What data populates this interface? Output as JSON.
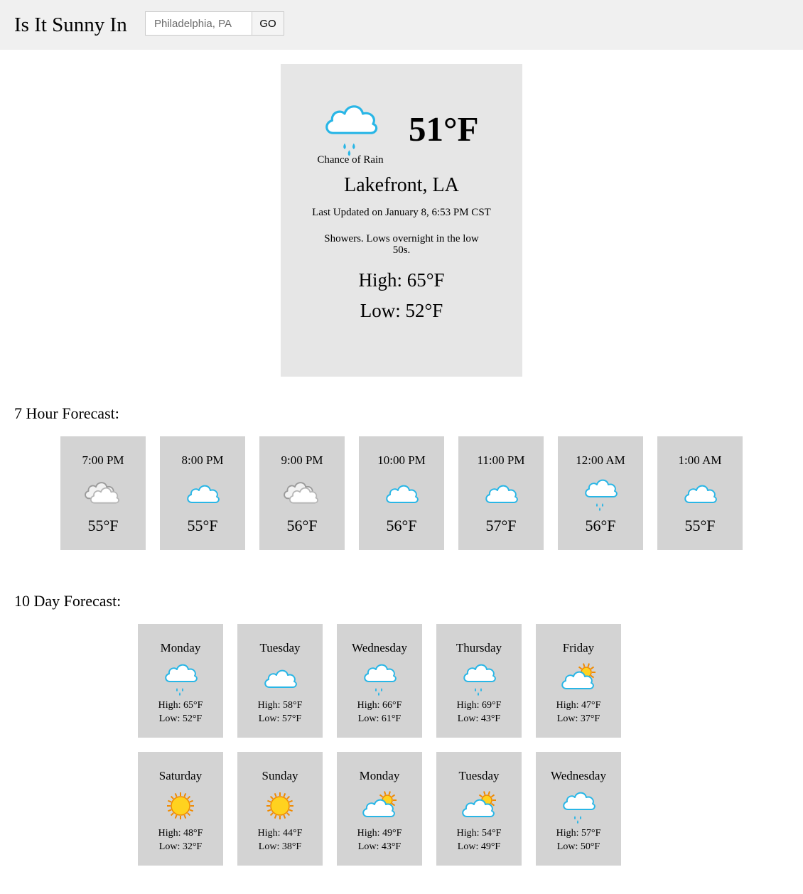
{
  "header": {
    "title": "Is It Sunny In",
    "search_placeholder": "Philadelphia, PA",
    "go_label": "GO"
  },
  "current": {
    "icon": "chance-rain-icon",
    "temperature": "51°F",
    "condition": "Chance of Rain",
    "location": "Lakefront, LA",
    "last_updated": "Last Updated on January 8, 6:53 PM CST",
    "summary": "Showers. Lows overnight in the low 50s.",
    "high": "High: 65°F",
    "low": "Low: 52°F"
  },
  "hourly": {
    "heading": "7 Hour Forecast:",
    "items": [
      {
        "time": "7:00 PM",
        "icon": "cloudy-icon",
        "temp": "55°F"
      },
      {
        "time": "8:00 PM",
        "icon": "mostly-cloudy-icon",
        "temp": "55°F"
      },
      {
        "time": "9:00 PM",
        "icon": "cloudy-icon",
        "temp": "56°F"
      },
      {
        "time": "10:00 PM",
        "icon": "mostly-cloudy-icon",
        "temp": "56°F"
      },
      {
        "time": "11:00 PM",
        "icon": "mostly-cloudy-icon",
        "temp": "57°F"
      },
      {
        "time": "12:00 AM",
        "icon": "chance-rain-icon",
        "temp": "56°F"
      },
      {
        "time": "1:00 AM",
        "icon": "mostly-cloudy-icon",
        "temp": "55°F"
      }
    ]
  },
  "daily": {
    "heading": "10 Day Forecast:",
    "items": [
      {
        "day": "Monday",
        "icon": "chance-rain-icon",
        "high": "High: 65°F",
        "low": "Low: 52°F"
      },
      {
        "day": "Tuesday",
        "icon": "mostly-cloudy-icon",
        "high": "High: 58°F",
        "low": "Low: 57°F"
      },
      {
        "day": "Wednesday",
        "icon": "chance-rain-icon",
        "high": "High: 66°F",
        "low": "Low: 61°F"
      },
      {
        "day": "Thursday",
        "icon": "chance-rain-icon",
        "high": "High: 69°F",
        "low": "Low: 43°F"
      },
      {
        "day": "Friday",
        "icon": "partly-cloudy-icon",
        "high": "High: 47°F",
        "low": "Low: 37°F"
      },
      {
        "day": "Saturday",
        "icon": "sunny-icon",
        "high": "High: 48°F",
        "low": "Low: 32°F"
      },
      {
        "day": "Sunday",
        "icon": "sunny-icon",
        "high": "High: 44°F",
        "low": "Low: 38°F"
      },
      {
        "day": "Monday",
        "icon": "partly-cloudy-icon",
        "high": "High: 49°F",
        "low": "Low: 43°F"
      },
      {
        "day": "Tuesday",
        "icon": "partly-cloudy-icon",
        "high": "High: 54°F",
        "low": "Low: 49°F"
      },
      {
        "day": "Wednesday",
        "icon": "chance-rain-icon",
        "high": "High: 57°F",
        "low": "Low: 50°F"
      }
    ]
  },
  "colors": {
    "header_bg": "#f0f0f0",
    "current_card_bg": "#e6e6e6",
    "forecast_card_bg": "#d3d3d3",
    "cloud_outline": "#29b6e6",
    "rain_drop": "#29b6e6",
    "sun_fill": "#ffd21f",
    "sun_outline": "#f08a00",
    "gray_cloud": "#9a9a9a"
  }
}
